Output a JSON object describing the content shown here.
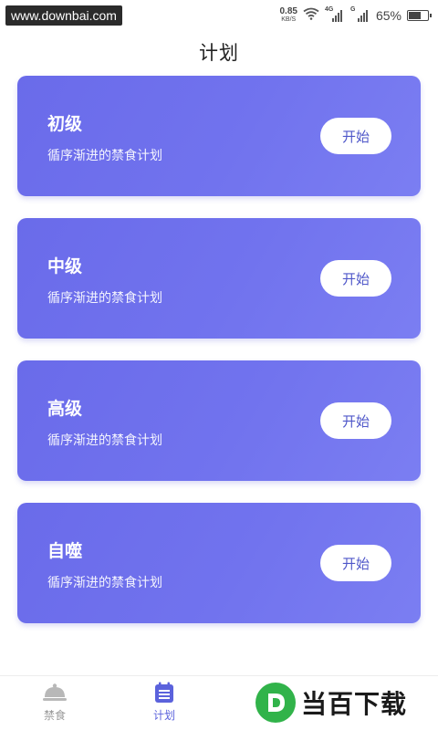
{
  "status_bar": {
    "watermark": "www.downbai.com",
    "speed_value": "0.85",
    "speed_unit": "KB/S",
    "signal1_tag": "4G",
    "signal2_tag": "G",
    "battery": "65%",
    "battery_level": 0.65
  },
  "page": {
    "title": "计划"
  },
  "plans": [
    {
      "name": "初级",
      "desc": "循序渐进的禁食计划",
      "button": "开始"
    },
    {
      "name": "中级",
      "desc": "循序渐进的禁食计划",
      "button": "开始"
    },
    {
      "name": "高级",
      "desc": "循序渐进的禁食计划",
      "button": "开始"
    },
    {
      "name": "自噬",
      "desc": "循序渐进的禁食计划",
      "button": "开始"
    }
  ],
  "bottom_nav": {
    "items": [
      {
        "label": "禁食",
        "icon": "cloche-icon",
        "active": false
      },
      {
        "label": "计划",
        "icon": "plan-list-icon",
        "active": true
      }
    ]
  },
  "brand_watermark": {
    "text": "当百下载",
    "icon": "d-logo-icon"
  },
  "colors": {
    "card": "#6c6eec",
    "accent": "#5b62dc",
    "brand_green": "#31b34a"
  }
}
